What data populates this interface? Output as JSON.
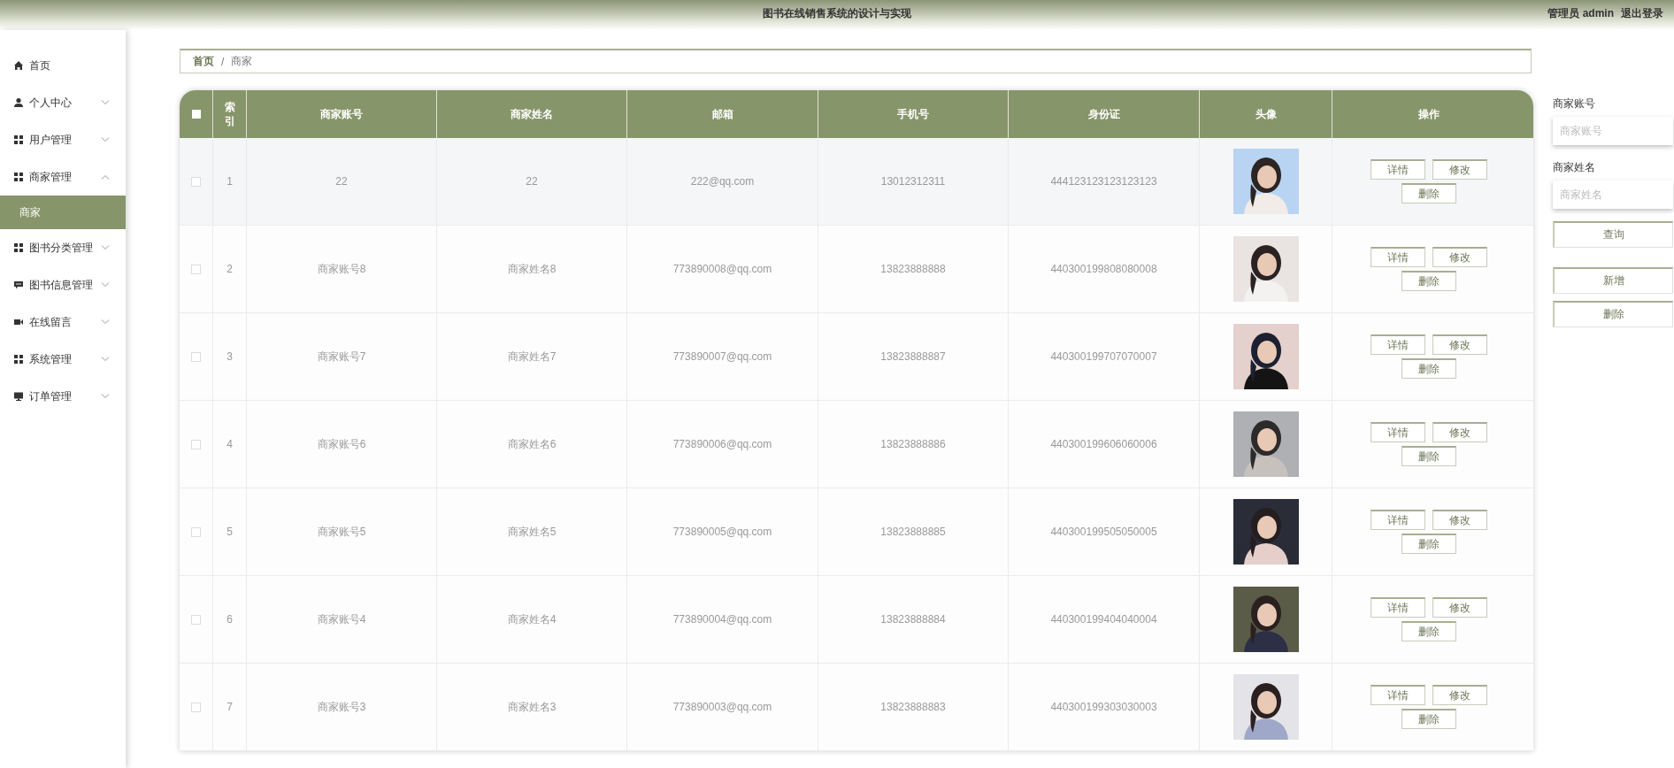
{
  "header": {
    "title": "图书在线销售系统的设计与实现",
    "role": "管理员",
    "user": "admin",
    "logout": "退出登录"
  },
  "sidebar": {
    "items": [
      {
        "label": "首页",
        "selected": false
      },
      {
        "label": "个人中心",
        "selected": false,
        "expanded": false
      },
      {
        "label": "用户管理",
        "selected": false,
        "expanded": false
      },
      {
        "label": "商家管理",
        "selected": false,
        "expanded": true,
        "children": [
          {
            "label": "商家",
            "selected": true
          }
        ]
      },
      {
        "label": "图书分类管理",
        "selected": false,
        "expanded": false
      },
      {
        "label": "图书信息管理",
        "selected": false,
        "expanded": false
      },
      {
        "label": "在线留言",
        "selected": false,
        "expanded": false
      },
      {
        "label": "系统管理",
        "selected": false,
        "expanded": false
      },
      {
        "label": "订单管理",
        "selected": false,
        "expanded": false
      }
    ]
  },
  "breadcrumb": {
    "items": [
      "首页",
      "商家"
    ],
    "separator": "/"
  },
  "table": {
    "select_all": {
      "checked": false
    },
    "columns": [
      "索引",
      "商家账号",
      "商家姓名",
      "邮箱",
      "手机号",
      "身份证",
      "头像",
      "操作"
    ],
    "rows": [
      {
        "checked": false,
        "index": "1",
        "account": "22",
        "name": "22",
        "email": "222@qq.com",
        "phone": "13012312311",
        "id_card": "444123123123123123",
        "actions": [
          "详情",
          "修改",
          "删除"
        ]
      },
      {
        "checked": false,
        "index": "2",
        "account": "商家账号8",
        "name": "商家姓名8",
        "email": "773890008@qq.com",
        "phone": "13823888888",
        "id_card": "440300199808080008",
        "actions": [
          "详情",
          "修改",
          "删除"
        ]
      },
      {
        "checked": false,
        "index": "3",
        "account": "商家账号7",
        "name": "商家姓名7",
        "email": "773890007@qq.com",
        "phone": "13823888887",
        "id_card": "440300199707070007",
        "actions": [
          "详情",
          "修改",
          "删除"
        ]
      },
      {
        "checked": false,
        "index": "4",
        "account": "商家账号6",
        "name": "商家姓名6",
        "email": "773890006@qq.com",
        "phone": "13823888886",
        "id_card": "440300199606060006",
        "actions": [
          "详情",
          "修改",
          "删除"
        ]
      },
      {
        "checked": false,
        "index": "5",
        "account": "商家账号5",
        "name": "商家姓名5",
        "email": "773890005@qq.com",
        "phone": "13823888885",
        "id_card": "440300199505050005",
        "actions": [
          "详情",
          "修改",
          "删除"
        ]
      },
      {
        "checked": false,
        "index": "6",
        "account": "商家账号4",
        "name": "商家姓名4",
        "email": "773890004@qq.com",
        "phone": "13823888884",
        "id_card": "440300199404040004",
        "actions": [
          "详情",
          "修改",
          "删除"
        ]
      },
      {
        "checked": false,
        "index": "7",
        "account": "商家账号3",
        "name": "商家姓名3",
        "email": "773890003@qq.com",
        "phone": "13823888883",
        "id_card": "440300199303030003",
        "actions": [
          "详情",
          "修改",
          "删除"
        ]
      }
    ]
  },
  "search": {
    "fields": [
      {
        "label": "商家账号",
        "placeholder": "商家账号"
      },
      {
        "label": "商家姓名",
        "placeholder": "商家姓名"
      }
    ],
    "buttons": [
      "查询",
      "新增",
      "删除"
    ]
  }
}
